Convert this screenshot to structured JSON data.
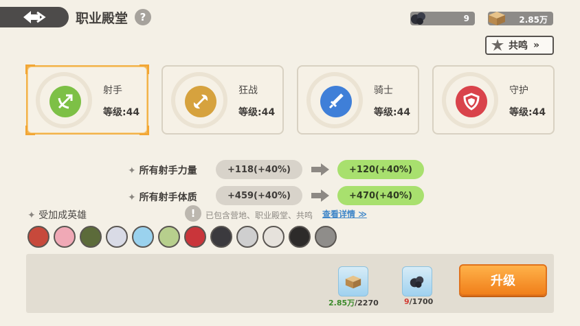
{
  "header": {
    "title": "职业殿堂",
    "help": "?"
  },
  "resources": {
    "ore": "9",
    "crate": "2.85万"
  },
  "resonance_button": {
    "label": "共鸣"
  },
  "classes": [
    {
      "name": "射手",
      "level": "等级:44",
      "color": "#7dc046"
    },
    {
      "name": "狂战",
      "level": "等级:44",
      "color": "#d6a23e"
    },
    {
      "name": "骑士",
      "level": "等级:44",
      "color": "#3f7fd8"
    },
    {
      "name": "守护",
      "level": "等级:44",
      "color": "#d9434b"
    }
  ],
  "stats": [
    {
      "label": "所有射手力量",
      "current": "+118(+40%)",
      "next": "+120(+40%)"
    },
    {
      "label": "所有射手体质",
      "current": "+459(+40%)",
      "next": "+470(+40%)"
    }
  ],
  "heroes_section": {
    "label": "受加成英雄",
    "warn": "!",
    "note": "已包含营地、职业殿堂、共鸣",
    "details_link": "查看详情"
  },
  "cost": {
    "crate_have": "2.85万",
    "crate_need": "/2270",
    "ore_have": "9",
    "ore_need": "/1700",
    "have_ok_color": "#3b8a2a",
    "have_short_color": "#d23a32"
  },
  "upgrade_button": {
    "label": "升级"
  }
}
